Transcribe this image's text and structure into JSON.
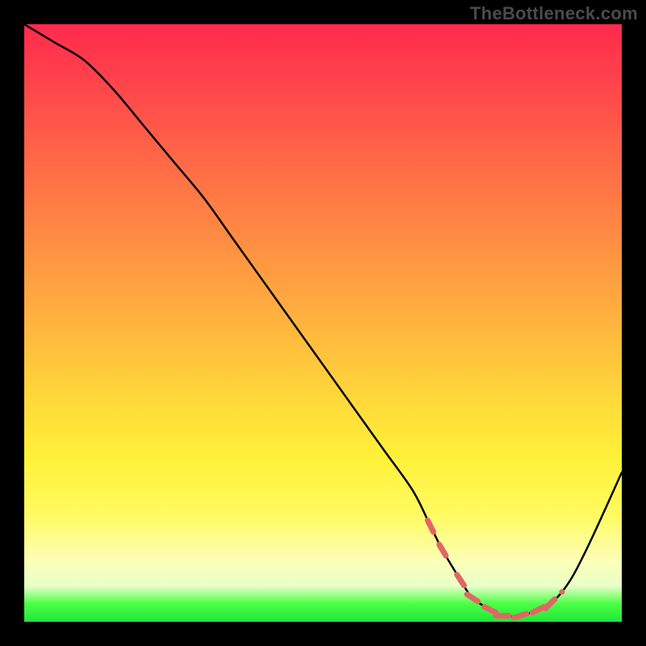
{
  "watermark": "TheBottleneck.com",
  "colors": {
    "background": "#000000",
    "gradient_top": "#ff2a4d",
    "gradient_mid": "#ffd13b",
    "gradient_bottom": "#1fe63a",
    "curve_stroke": "#000000",
    "marker_fill": "#e06666",
    "watermark_text": "#4b4b4b"
  },
  "chart_data": {
    "type": "line",
    "title": "",
    "xlabel": "",
    "ylabel": "",
    "xlim": [
      0,
      100
    ],
    "ylim": [
      0,
      100
    ],
    "grid": false,
    "series": [
      {
        "name": "bottleneck-curve",
        "x": [
          0,
          5,
          10,
          15,
          20,
          25,
          30,
          35,
          40,
          45,
          50,
          55,
          60,
          65,
          68,
          70,
          73,
          75,
          78,
          80,
          83,
          86,
          88,
          90,
          92,
          95,
          100
        ],
        "y": [
          100,
          97,
          94,
          89,
          83,
          77,
          71,
          64,
          57,
          50,
          43,
          36,
          29,
          22,
          16,
          12,
          7,
          4,
          2,
          1,
          1,
          2,
          3,
          5,
          8,
          14,
          25
        ]
      }
    ],
    "markers": {
      "name": "highlight-range",
      "x": [
        68,
        70,
        73,
        75,
        78,
        80,
        83,
        86,
        88,
        90
      ],
      "y": [
        16,
        12,
        7,
        4,
        2,
        1,
        1,
        2,
        3,
        5
      ]
    }
  }
}
